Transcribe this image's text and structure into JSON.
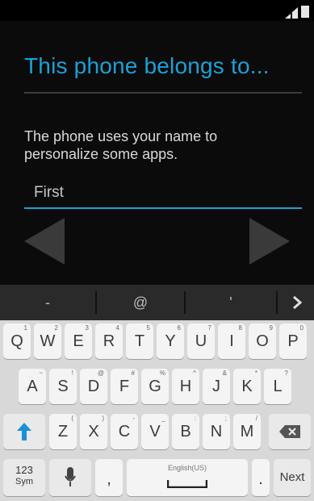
{
  "status_bar": {
    "signal_icon": "signal-icon",
    "battery_icon": "battery-icon"
  },
  "title": "This phone belongs to...",
  "description": "The phone uses your name to personalize some apps.",
  "first_name_field": {
    "placeholder": "First"
  },
  "nav": {
    "back_icon": "back-arrow-icon",
    "next_icon": "next-arrow-icon"
  },
  "suggestions": [
    "-",
    "@",
    "'"
  ],
  "suggestion_more_icon": "chevron-right-icon",
  "keyboard": {
    "row1": [
      {
        "key": "Q",
        "hint": "1"
      },
      {
        "key": "W",
        "hint": "2"
      },
      {
        "key": "E",
        "hint": "3"
      },
      {
        "key": "R",
        "hint": "4"
      },
      {
        "key": "T",
        "hint": "5"
      },
      {
        "key": "Y",
        "hint": "6"
      },
      {
        "key": "U",
        "hint": "7"
      },
      {
        "key": "I",
        "hint": "8"
      },
      {
        "key": "O",
        "hint": "9"
      },
      {
        "key": "P",
        "hint": "0"
      }
    ],
    "row2": [
      {
        "key": "A",
        "hint": "~"
      },
      {
        "key": "S",
        "hint": "!"
      },
      {
        "key": "D",
        "hint": "@"
      },
      {
        "key": "F",
        "hint": "#"
      },
      {
        "key": "G",
        "hint": "%"
      },
      {
        "key": "H",
        "hint": "^"
      },
      {
        "key": "J",
        "hint": "&"
      },
      {
        "key": "K",
        "hint": "*"
      },
      {
        "key": "L",
        "hint": "?"
      }
    ],
    "row3": [
      {
        "key": "Z",
        "hint": "("
      },
      {
        "key": "X",
        "hint": ")"
      },
      {
        "key": "C",
        "hint": "-"
      },
      {
        "key": "V",
        "hint": "_"
      },
      {
        "key": "B",
        "hint": ":"
      },
      {
        "key": "N",
        "hint": ";"
      },
      {
        "key": "M",
        "hint": "/"
      }
    ],
    "shift_icon": "shift-up-arrow-icon",
    "backspace_icon": "backspace-icon",
    "sym_top": "123",
    "sym_bottom": "Sym",
    "mic_icon": "microphone-icon",
    "comma": ",",
    "space_label": "English(US)",
    "period": ".",
    "next": "Next"
  }
}
